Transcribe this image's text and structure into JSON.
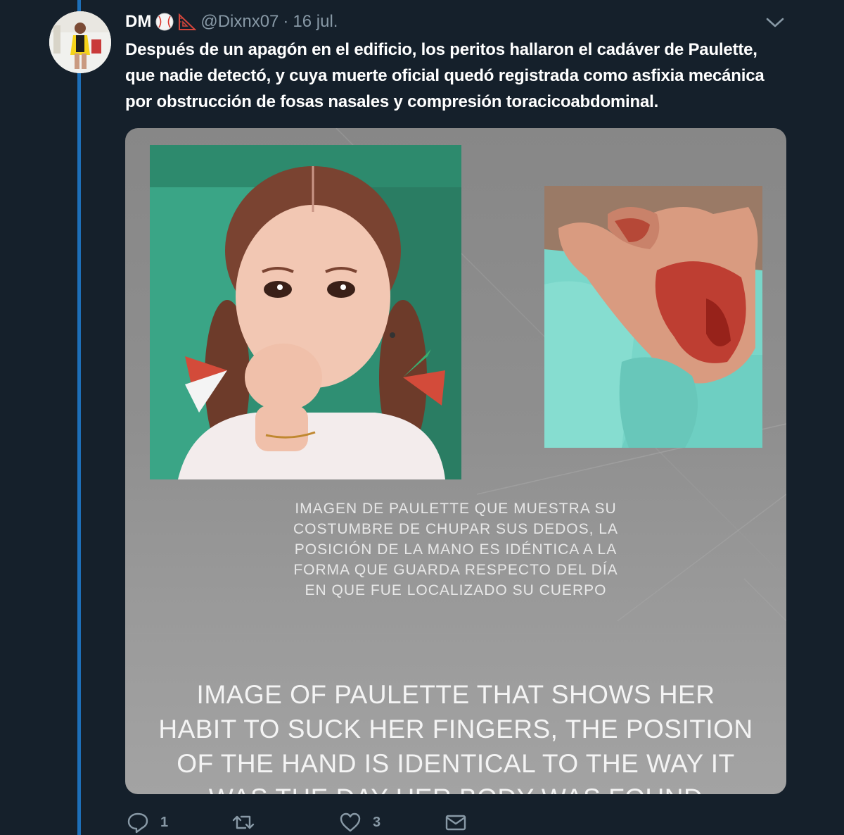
{
  "tweet": {
    "display_name": "DM",
    "badge_icons": [
      "baseball-emoji",
      "triangular-ruler-emoji"
    ],
    "handle": "@Dixnx07",
    "separator": "·",
    "date": "16 jul.",
    "text_lines": [
      "Después de un apagón en el edificio, los peritos hallaron el cadáver de Paulette,",
      "que nadie detectó, y cuya muerte oficial quedó registrada como asfixia mecánica",
      "por obstrucción de fosas nasales y compresión toracicoabdominal."
    ]
  },
  "media": {
    "left_photo": "girl-with-braids-photo",
    "right_photo": "hand-photo",
    "caption_es_lines": [
      "IMAGEN DE PAULETTE QUE MUESTRA SU",
      "COSTUMBRE DE CHUPAR SUS DEDOS, LA",
      "POSICIÓN DE LA MANO ES IDÉNTICA A LA",
      "FORMA QUE GUARDA RESPECTO DEL DÍA",
      "EN QUE FUE LOCALIZADO SU CUERPO"
    ],
    "caption_en_lines": [
      "IMAGE OF PAULETTE THAT SHOWS HER",
      "HABIT TO SUCK HER FINGERS, THE POSITION",
      "OF THE HAND IS IDENTICAL TO THE WAY IT",
      "WAS THE DAY HER BODY WAS FOUND"
    ]
  },
  "actions": {
    "reply_count": "1",
    "retweet_count": "",
    "like_count": "3",
    "icons": [
      "reply-icon",
      "retweet-icon",
      "like-icon",
      "dm-icon"
    ]
  },
  "colors": {
    "background": "#15202b",
    "thread_line": "#1d6fb8",
    "secondary_text": "#8899a6",
    "primary_text": "#ffffff"
  }
}
